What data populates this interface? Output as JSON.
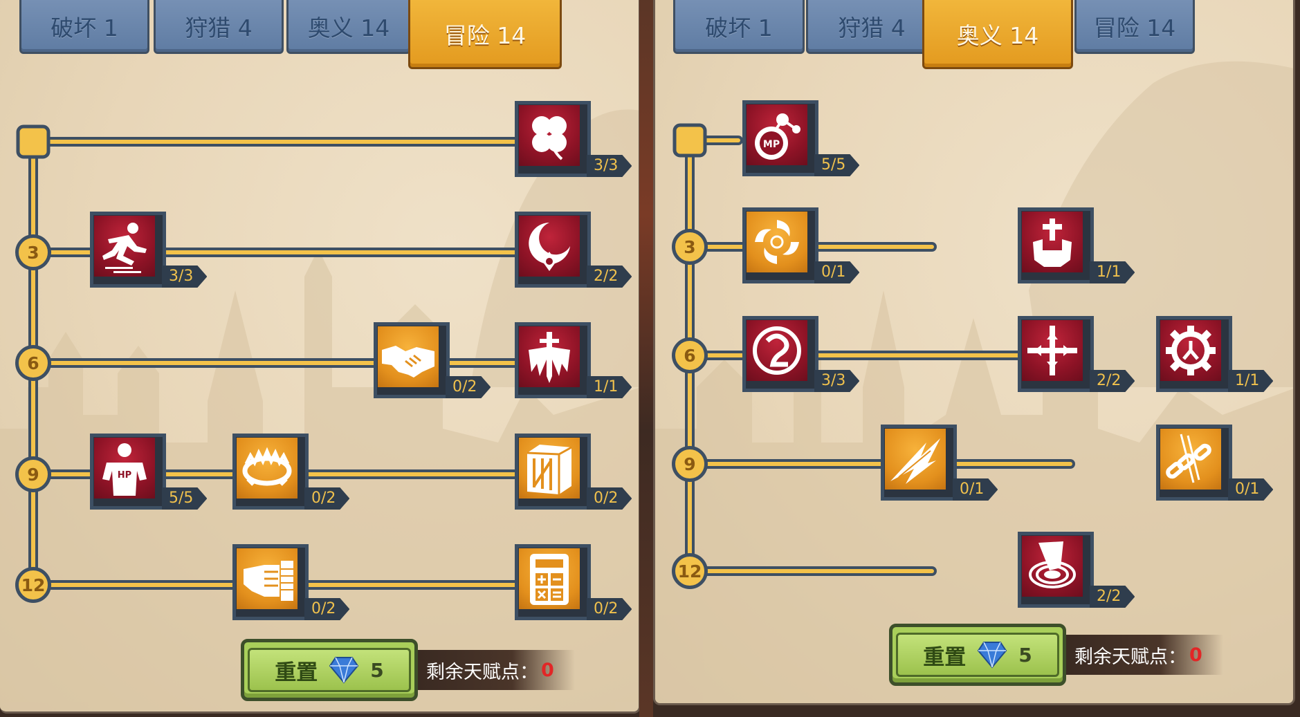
{
  "left_panel": {
    "tabs": [
      {
        "label": "破坏 1",
        "active": false
      },
      {
        "label": "狩猎 4",
        "active": false
      },
      {
        "label": "奥义 14",
        "active": false
      },
      {
        "label": "冒险 14",
        "active": true
      }
    ],
    "levels": [
      "3",
      "6",
      "9",
      "12"
    ],
    "nodes": [
      {
        "icon": "clover-icon",
        "count": "3/3",
        "color": "red"
      },
      {
        "icon": "sprint-icon",
        "count": "3/3",
        "color": "red"
      },
      {
        "icon": "crescent-slash-icon",
        "count": "2/2",
        "color": "red"
      },
      {
        "icon": "handshake-icon",
        "count": "0/2",
        "color": "orange"
      },
      {
        "icon": "sword-wings-icon",
        "count": "1/1",
        "color": "red"
      },
      {
        "icon": "hp-man-icon",
        "count": "5/5",
        "color": "red"
      },
      {
        "icon": "bear-trap-icon",
        "count": "0/2",
        "color": "orange"
      },
      {
        "icon": "crate-icon",
        "count": "0/2",
        "color": "orange"
      },
      {
        "icon": "fist-icon",
        "count": "0/2",
        "color": "orange"
      },
      {
        "icon": "calculator-icon",
        "count": "0/2",
        "color": "orange"
      }
    ],
    "reset": {
      "label": "重置",
      "cost": "5"
    },
    "points": {
      "label": "剩余天赋点：",
      "value": "0"
    }
  },
  "right_panel": {
    "tabs": [
      {
        "label": "破坏 1",
        "active": false
      },
      {
        "label": "狩猎 4",
        "active": false
      },
      {
        "label": "奥义 14",
        "active": true
      },
      {
        "label": "冒险 14",
        "active": false
      }
    ],
    "levels": [
      "3",
      "6",
      "9",
      "12"
    ],
    "nodes": [
      {
        "icon": "mp-potion-icon",
        "count": "5/5",
        "color": "red"
      },
      {
        "icon": "vortex-icon",
        "count": "0/1",
        "color": "orange"
      },
      {
        "icon": "holy-hand-icon",
        "count": "1/1",
        "color": "red"
      },
      {
        "icon": "swirl-orb-icon",
        "count": "3/3",
        "color": "red"
      },
      {
        "icon": "cross-target-icon",
        "count": "2/2",
        "color": "red"
      },
      {
        "icon": "gear-hand-icon",
        "count": "1/1",
        "color": "red"
      },
      {
        "icon": "lightning-claw-icon",
        "count": "0/1",
        "color": "orange"
      },
      {
        "icon": "broken-chain-icon",
        "count": "0/1",
        "color": "orange"
      },
      {
        "icon": "vortex-slash-icon",
        "count": "2/2",
        "color": "red"
      }
    ],
    "reset": {
      "label": "重置",
      "cost": "5"
    },
    "points": {
      "label": "剩余天赋点：",
      "value": "0"
    }
  }
}
